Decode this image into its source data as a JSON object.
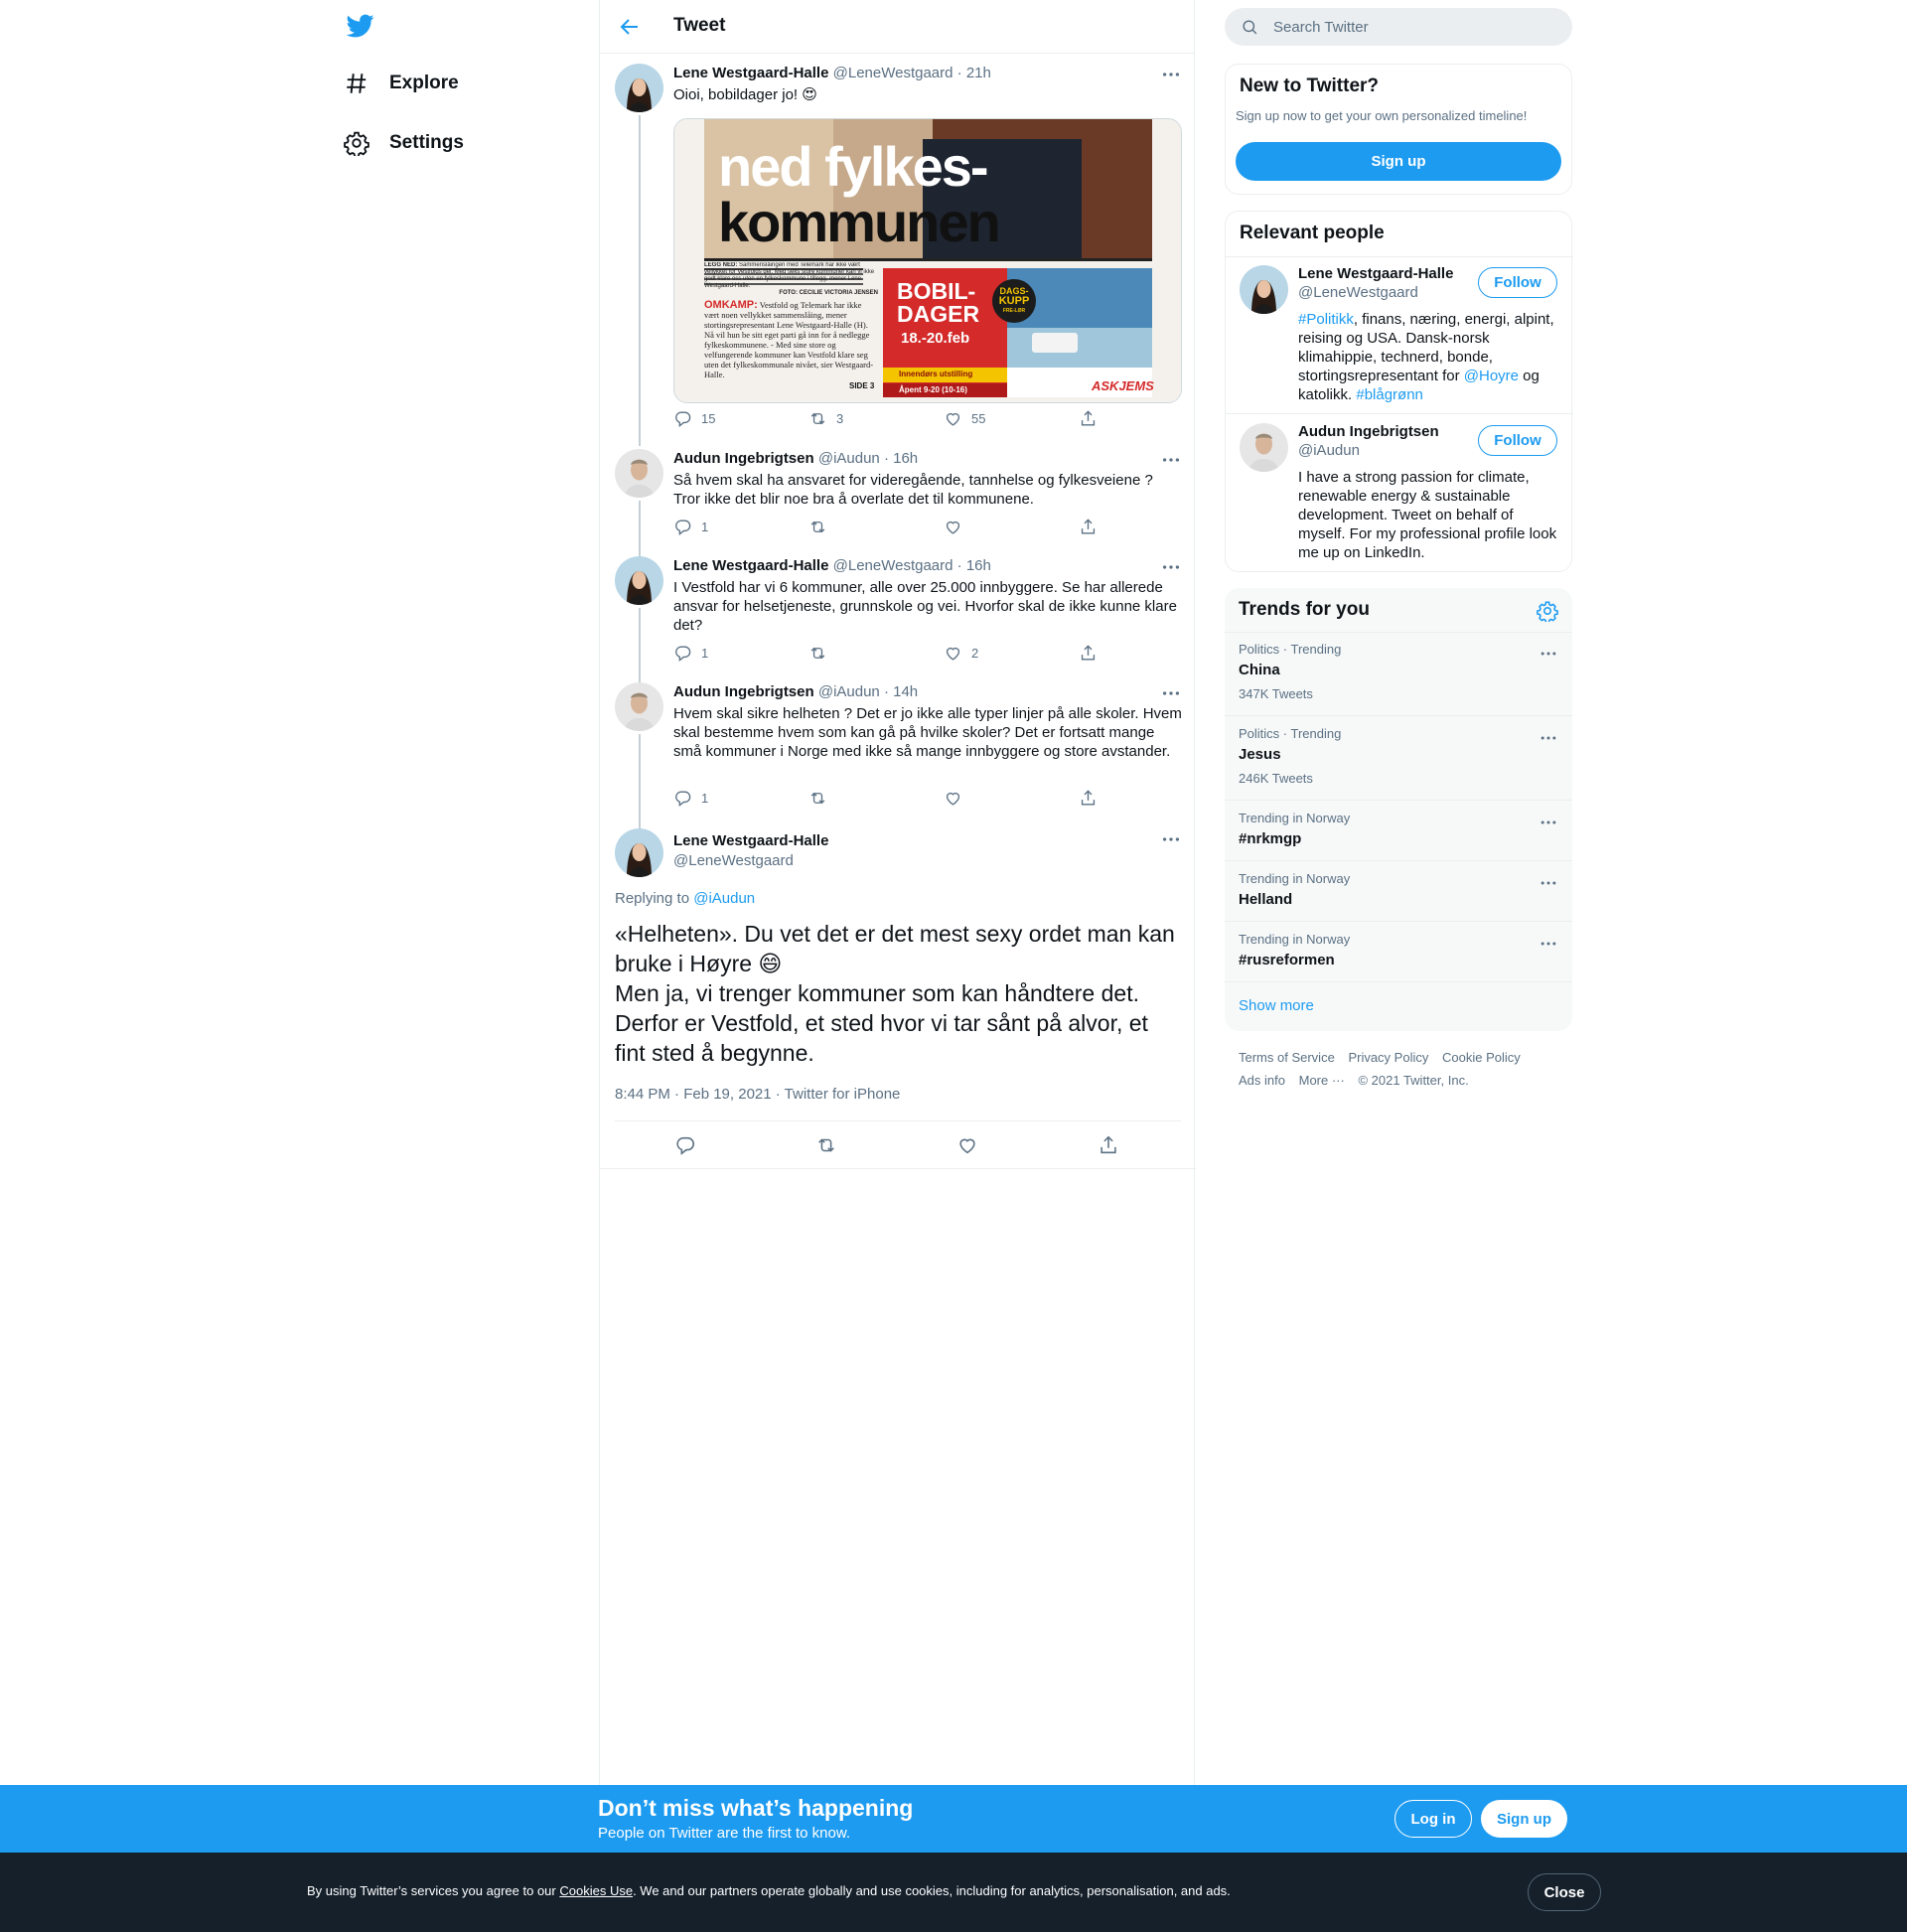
{
  "colors": {
    "accent": "#1d9bf0",
    "text": "#0f1419",
    "secondary": "#5b7083",
    "border": "#ebeef0",
    "cookie_bg": "#15202b"
  },
  "nav": {
    "logo_icon": "twitter-bird-icon",
    "items": [
      {
        "label": "Explore",
        "icon": "hashtag-icon"
      },
      {
        "label": "Settings",
        "icon": "gear-icon"
      }
    ]
  },
  "header": {
    "title": "Tweet",
    "back_icon": "arrow-left-icon"
  },
  "thread": [
    {
      "name": "Lene Westgaard-Halle",
      "handle": "@LeneWestgaard",
      "sep": "·",
      "time": "21h",
      "text": "Oioi, bobildager jo! 😍",
      "media": {
        "headline_1": "ned fylkes-",
        "headline_2": "kommunen",
        "caption_label": "LEGG NED:",
        "caption": "Sammenslåingen med Telemark har ikke vært vellykket for Vestfolds del. Med seks store kommuner kan vi ikke godt klare oss uten en fylkeskommune i tillegg, mener Lene Westgaard-Halle.",
        "photo_credit": "FOTO: CECILIE VICTORIA JENSEN",
        "omkamp_label": "OMKAMP:",
        "omkamp_text": "Vestfold og Telemark har ikke vært noen vellykket sammenslåing, mener stortingsrepresentant Lene Westgaard-Halle (H). Nå vil hun be sitt eget parti gå inn for å nedlegge fylkeskommunene. - Med sine store og velfungerende kommuner kan Vestfold klare seg uten det fylkeskommunale nivået, sier Westgaard-Halle.",
        "side": "SIDE 3",
        "ad_title_1": "BOBIL-",
        "ad_title_2": "DAGER",
        "ad_dates": "18.-20.feb",
        "ad_badge_1": "DAGS-",
        "ad_badge_2": "KUPP",
        "ad_badge_3": "FRE-LØR",
        "ad_indoor": "Innendørs utstilling",
        "ad_hours": "Åpent 9-20 (10-16)",
        "ad_brand": "ASKJEMS"
      },
      "replies": "15",
      "retweets": "3",
      "likes": "55"
    },
    {
      "name": "Audun Ingebrigtsen",
      "handle": "@iAudun",
      "sep": "·",
      "time": "16h",
      "text": "Så hvem skal ha ansvaret for videregående, tannhelse og fylkesveiene ? Tror ikke det blir noe bra å overlate det til kommunene.",
      "replies": "1",
      "retweets": "",
      "likes": ""
    },
    {
      "name": "Lene Westgaard-Halle",
      "handle": "@LeneWestgaard",
      "sep": "·",
      "time": "16h",
      "text": "I Vestfold har vi 6 kommuner, alle over 25.000 innbyggere. Se har allerede ansvar for helsetjeneste, grunnskole og vei. Hvorfor skal de ikke kunne klare det?",
      "replies": "1",
      "retweets": "",
      "likes": "2"
    },
    {
      "name": "Audun Ingebrigtsen",
      "handle": "@iAudun",
      "sep": "·",
      "time": "14h",
      "text": "Hvem skal sikre helheten ? Det er jo ikke alle typer linjer på alle skoler. Hvem skal bestemme hvem som kan gå på hvilke skoler? Det er fortsatt mange små kommuner i Norge med ikke så mange innbyggere og store avstander.",
      "replies": "1",
      "retweets": "",
      "likes": ""
    }
  ],
  "focus": {
    "name": "Lene Westgaard-Halle",
    "handle": "@LeneWestgaard",
    "replying_prefix": "Replying to",
    "replying_to": "@iAudun",
    "line1": "«Helheten». Du vet det er det mest sexy ordet man kan bruke i Høyre 😄",
    "line2": "Men ja, vi trenger kommuner som kan håndtere det. Derfor er Vestfold, et sted hvor vi tar sånt på alvor, et fint sted å begynne.",
    "timestamp": "8:44 PM · Feb 19, 2021",
    "source_sep": " · ",
    "source": "Twitter for iPhone"
  },
  "search": {
    "placeholder": "Search Twitter"
  },
  "new_to_twitter": {
    "title": "New to Twitter?",
    "subtitle": "Sign up now to get your own personalized timeline!",
    "button": "Sign up"
  },
  "relevant": {
    "title": "Relevant people",
    "follow_label": "Follow",
    "people": [
      {
        "name": "Lene Westgaard-Halle",
        "handle": "@LeneWestgaard",
        "bio_tag": "#Politikk",
        "bio_1": ", finans, næring, energi, alpint, reising og USA. Dansk-norsk klimahippie, technerd, bonde, stortingsrepresentant for ",
        "bio_mention": "@Hoyre",
        "bio_2": " og katolikk. ",
        "bio_tag2": "#blågrønn"
      },
      {
        "name": "Audun Ingebrigtsen",
        "handle": "@iAudun",
        "bio": "I have a strong passion for climate, renewable energy & sustainable development. Tweet on behalf of myself. For my professional profile look me up on LinkedIn."
      }
    ]
  },
  "trends": {
    "title": "Trends for you",
    "items": [
      {
        "context": "Politics · Trending",
        "name": "China",
        "count": "347K Tweets"
      },
      {
        "context": "Politics · Trending",
        "name": "Jesus",
        "count": "246K Tweets"
      },
      {
        "context": "Trending in Norway",
        "name": "#nrkmgp",
        "count": ""
      },
      {
        "context": "Trending in Norway",
        "name": "Helland",
        "count": ""
      },
      {
        "context": "Trending in Norway",
        "name": "#rusreformen",
        "count": ""
      }
    ],
    "show_more": "Show more"
  },
  "footer": {
    "links": [
      "Terms of Service",
      "Privacy Policy",
      "Cookie Policy",
      "Ads info",
      "More ···"
    ],
    "copyright": "© 2021 Twitter, Inc."
  },
  "banner": {
    "title": "Don’t miss what’s happening",
    "subtitle": "People on Twitter are the first to know.",
    "login": "Log in",
    "signup": "Sign up"
  },
  "cookie": {
    "text_before": "By using Twitter’s services you agree to our ",
    "link": "Cookies Use",
    "text_after": ". We and our partners operate globally and use cookies, including for analytics, personalisation, and ads.",
    "close": "Close"
  }
}
